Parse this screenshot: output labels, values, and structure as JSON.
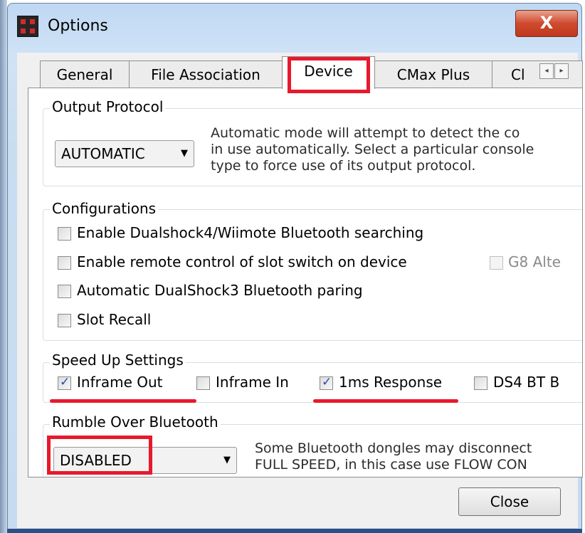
{
  "window": {
    "title": "Options",
    "close_glyph": "X"
  },
  "tabs": [
    {
      "label": "General",
      "active": false
    },
    {
      "label": "File Association",
      "active": false
    },
    {
      "label": "Device",
      "active": true
    },
    {
      "label": "CMax Plus",
      "active": false
    },
    {
      "label": "Cl",
      "active": false
    }
  ],
  "tab_scroll": {
    "left_icon": "◂",
    "right_icon": "▸"
  },
  "output_protocol": {
    "legend": "Output Protocol",
    "selected": "AUTOMATIC",
    "dropdown_icon": "▼",
    "info_lines": [
      "Automatic mode will attempt to detect the co",
      "in use automatically. Select a particular console",
      "type to force use of its output protocol."
    ]
  },
  "configurations": {
    "legend": "Configurations",
    "items": [
      {
        "label": "Enable Dualshock4/Wiimote Bluetooth searching",
        "checked": false
      },
      {
        "label": "Enable remote control of slot switch on device",
        "checked": false
      },
      {
        "label": "Automatic DualShock3 Bluetooth paring",
        "checked": false
      },
      {
        "label": "Slot Recall",
        "checked": false
      }
    ],
    "g8": {
      "label": "G8 Alte",
      "checked": false,
      "disabled": true
    }
  },
  "speed_up": {
    "legend": "Speed Up Settings",
    "items": [
      {
        "label": "Inframe Out",
        "checked": true
      },
      {
        "label": "Inframe In",
        "checked": false
      },
      {
        "label": "1ms Response",
        "checked": true
      },
      {
        "label": "DS4 BT B",
        "checked": false
      }
    ]
  },
  "rumble": {
    "legend": "Rumble Over Bluetooth",
    "selected": "DISABLED",
    "dropdown_icon": "▼",
    "info_lines": [
      "Some Bluetooth dongles may disconnect",
      "FULL SPEED, in this case use FLOW CON"
    ]
  },
  "footer": {
    "close_label": "Close"
  },
  "colors": {
    "highlight": "#e8192c",
    "check": "#2a49a8",
    "titlebar": "#c9ddf1",
    "close_button": "#cf4a2e"
  }
}
